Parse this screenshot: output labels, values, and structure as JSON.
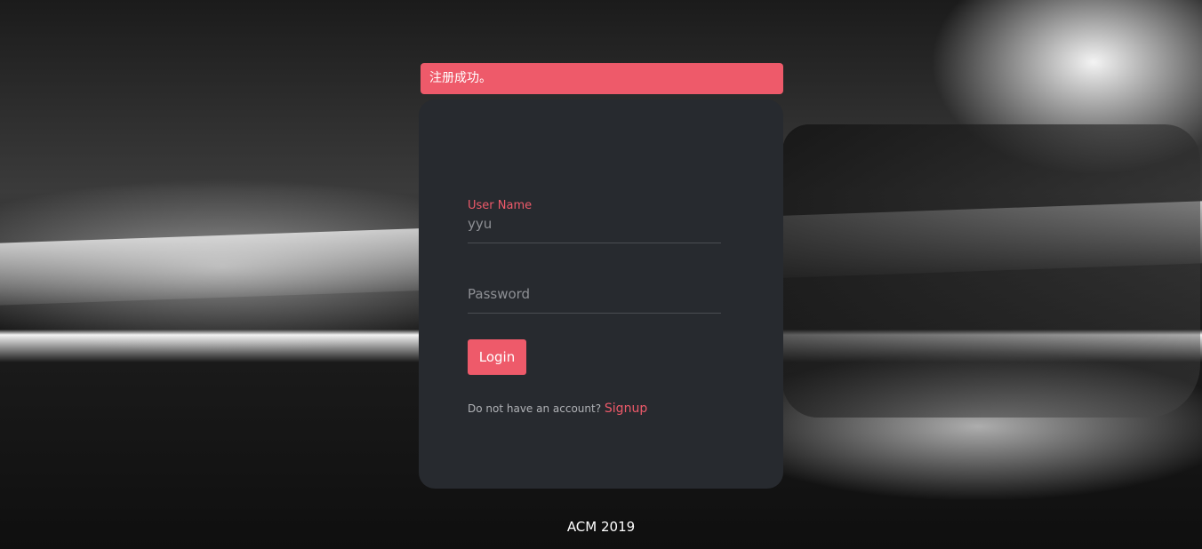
{
  "alert": {
    "message": "注册成功。"
  },
  "login_form": {
    "username_label": "User Name",
    "username_value": "yyu",
    "password_placeholder": "Password",
    "login_button": "Login",
    "signup_prompt": "Do not have an account?",
    "signup_link": "Signup"
  },
  "footer": {
    "text": "ACM 2019"
  },
  "colors": {
    "accent": "#ee5a6a",
    "card_bg": "#272a2f"
  }
}
